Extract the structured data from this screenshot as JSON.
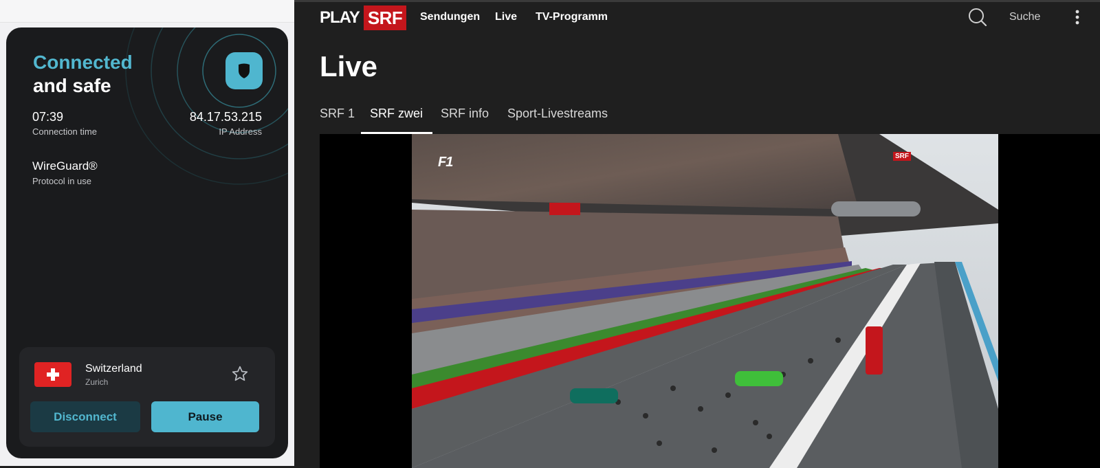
{
  "vpn": {
    "status_line1": "Connected",
    "status_line2": "and safe",
    "connection_time": "07:39",
    "connection_time_label": "Connection time",
    "ip_address": "84.17.53.215",
    "ip_label": "IP Address",
    "protocol": "WireGuard®",
    "protocol_label": "Protocol in use",
    "location": {
      "country": "Switzerland",
      "city": "Zurich",
      "flag_icon": "swiss-flag"
    },
    "buttons": {
      "disconnect": "Disconnect",
      "pause": "Pause"
    },
    "colors": {
      "accent": "#4fb6cf",
      "card": "#1a1b1d"
    }
  },
  "srf": {
    "logo": {
      "play": "PLAY",
      "srf": "SRF"
    },
    "nav": [
      "Sendungen",
      "Live",
      "TV-Programm"
    ],
    "search_label": "Suche",
    "page_title": "Live",
    "tabs": [
      "SRF 1",
      "SRF zwei",
      "SRF info",
      "Sport-Livestreams"
    ],
    "active_tab": "SRF zwei",
    "video": {
      "bug": "SRF",
      "overlay_mark": "F1"
    },
    "colors": {
      "brand_red": "#c4161c",
      "background": "#1f1f1f"
    }
  }
}
